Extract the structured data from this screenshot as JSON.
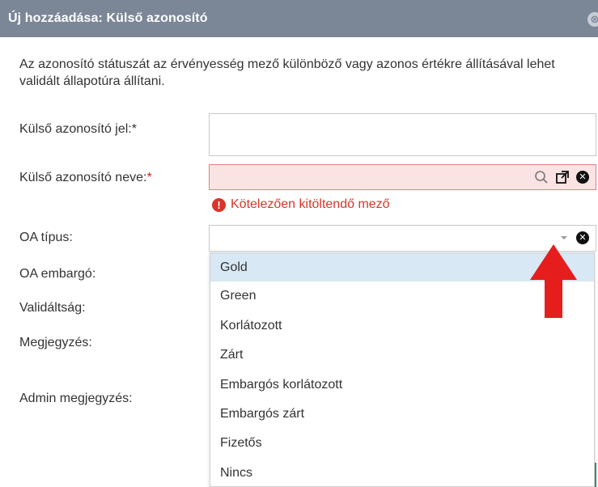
{
  "dialog": {
    "title": "Új hozzáadása: Külső azonosító",
    "close_glyph": "⊗",
    "description": "Az azonosító státuszát az érvényesség mező különböző vagy azonos értékre állításával lehet validált állapotúra állítani."
  },
  "form": {
    "external_id_label": "Külső azonosító jel:",
    "external_id_required": "*",
    "external_name_label": "Külső azonosító neve:",
    "external_name_required": "*",
    "required_error": "Kötelezően kitöltendő mező",
    "oa_type_label": "OA típus:",
    "oa_embargo_label": "OA embargó:",
    "validity_label": "Validáltság:",
    "note_label": "Megjegyzés:",
    "admin_note_label": "Admin megjegyzés:"
  },
  "oa_type_options": [
    "Gold",
    "Green",
    "Korlátozott",
    "Zárt",
    "Embargós korlátozott",
    "Embargós zárt",
    "Fizetős",
    "Nincs"
  ],
  "icons": {
    "search": "search-icon",
    "popup": "external-link-icon",
    "clear": "clear-icon",
    "error": "error-icon",
    "dropdown": "chevron-down-icon"
  },
  "colors": {
    "titlebar": "#7b8696",
    "error": "#d9352a",
    "selected_option": "#d8e8f5",
    "annotation_arrow": "#e61d1d"
  }
}
